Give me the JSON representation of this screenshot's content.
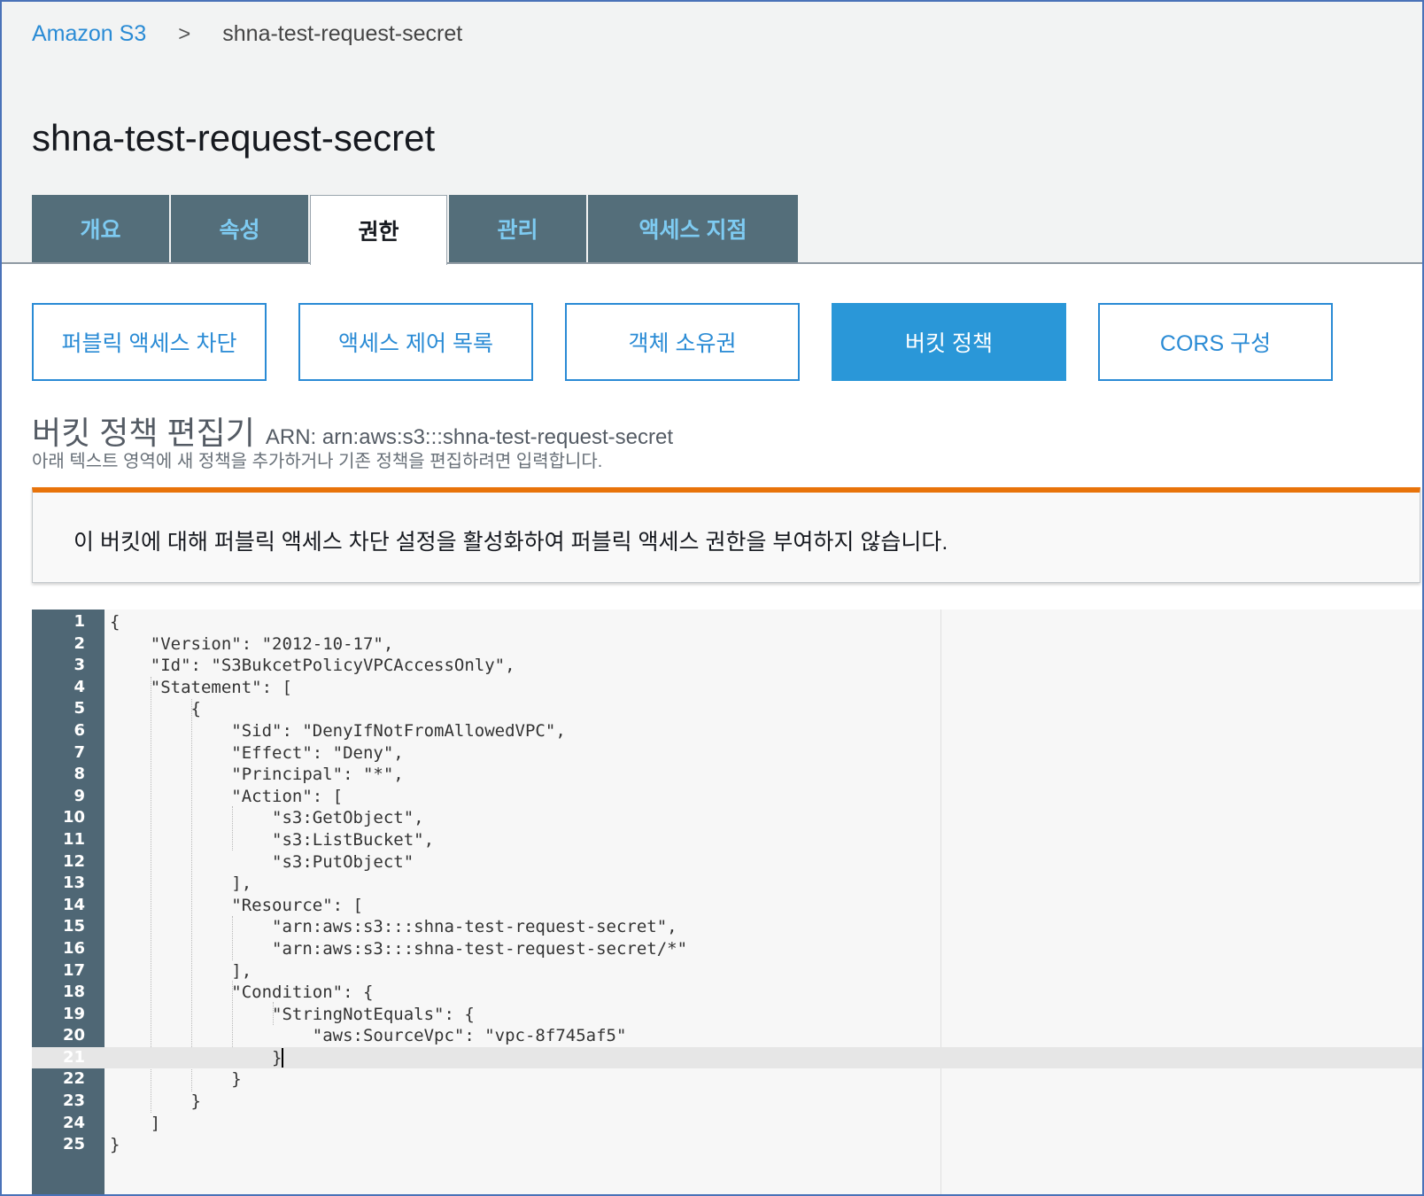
{
  "breadcrumb": {
    "root": "Amazon S3",
    "separator": ">",
    "current": "shna-test-request-secret"
  },
  "page_title": "shna-test-request-secret",
  "tabs": [
    {
      "label": "개요",
      "active": false
    },
    {
      "label": "속성",
      "active": false
    },
    {
      "label": "권한",
      "active": true
    },
    {
      "label": "관리",
      "active": false
    },
    {
      "label": "액세스 지점",
      "active": false
    }
  ],
  "subtabs": [
    {
      "label": "퍼블릭 액세스 차단",
      "active": false
    },
    {
      "label": "액세스 제어 목록",
      "active": false
    },
    {
      "label": "객체 소유권",
      "active": false
    },
    {
      "label": "버킷 정책",
      "active": true
    },
    {
      "label": "CORS 구성",
      "active": false
    }
  ],
  "editor": {
    "title": "버킷 정책 편집기",
    "arn": "ARN: arn:aws:s3:::shna-test-request-secret",
    "description": "아래 텍스트 영역에 새 정책을 추가하거나 기존 정책을 편집하려면 입력합니다."
  },
  "alert": {
    "text": "이 버킷에 대해 퍼블릭 액세스 차단 설정을 활성화하여 퍼블릭 액세스 권한을 부여하지 않습니다."
  },
  "code": {
    "active_line": 21,
    "lines": [
      "{",
      "    \"Version\": \"2012-10-17\",",
      "    \"Id\": \"S3BukcetPolicyVPCAccessOnly\",",
      "    \"Statement\": [",
      "        {",
      "            \"Sid\": \"DenyIfNotFromAllowedVPC\",",
      "            \"Effect\": \"Deny\",",
      "            \"Principal\": \"*\",",
      "            \"Action\": [",
      "                \"s3:GetObject\",",
      "                \"s3:ListBucket\",",
      "                \"s3:PutObject\"",
      "            ],",
      "            \"Resource\": [",
      "                \"arn:aws:s3:::shna-test-request-secret\",",
      "                \"arn:aws:s3:::shna-test-request-secret/*\"",
      "            ],",
      "            \"Condition\": {",
      "                \"StringNotEquals\": {",
      "                    \"aws:SourceVpc\": \"vpc-8f745af5\"",
      "                }",
      "            }",
      "        }",
      "    ]",
      "}"
    ]
  },
  "colors": {
    "tab_bg": "#546e7a",
    "tab_text": "#7ecbf2",
    "accent_blue": "#2a97d8",
    "alert_orange": "#e8730a",
    "gutter_bg": "#4f6775"
  }
}
